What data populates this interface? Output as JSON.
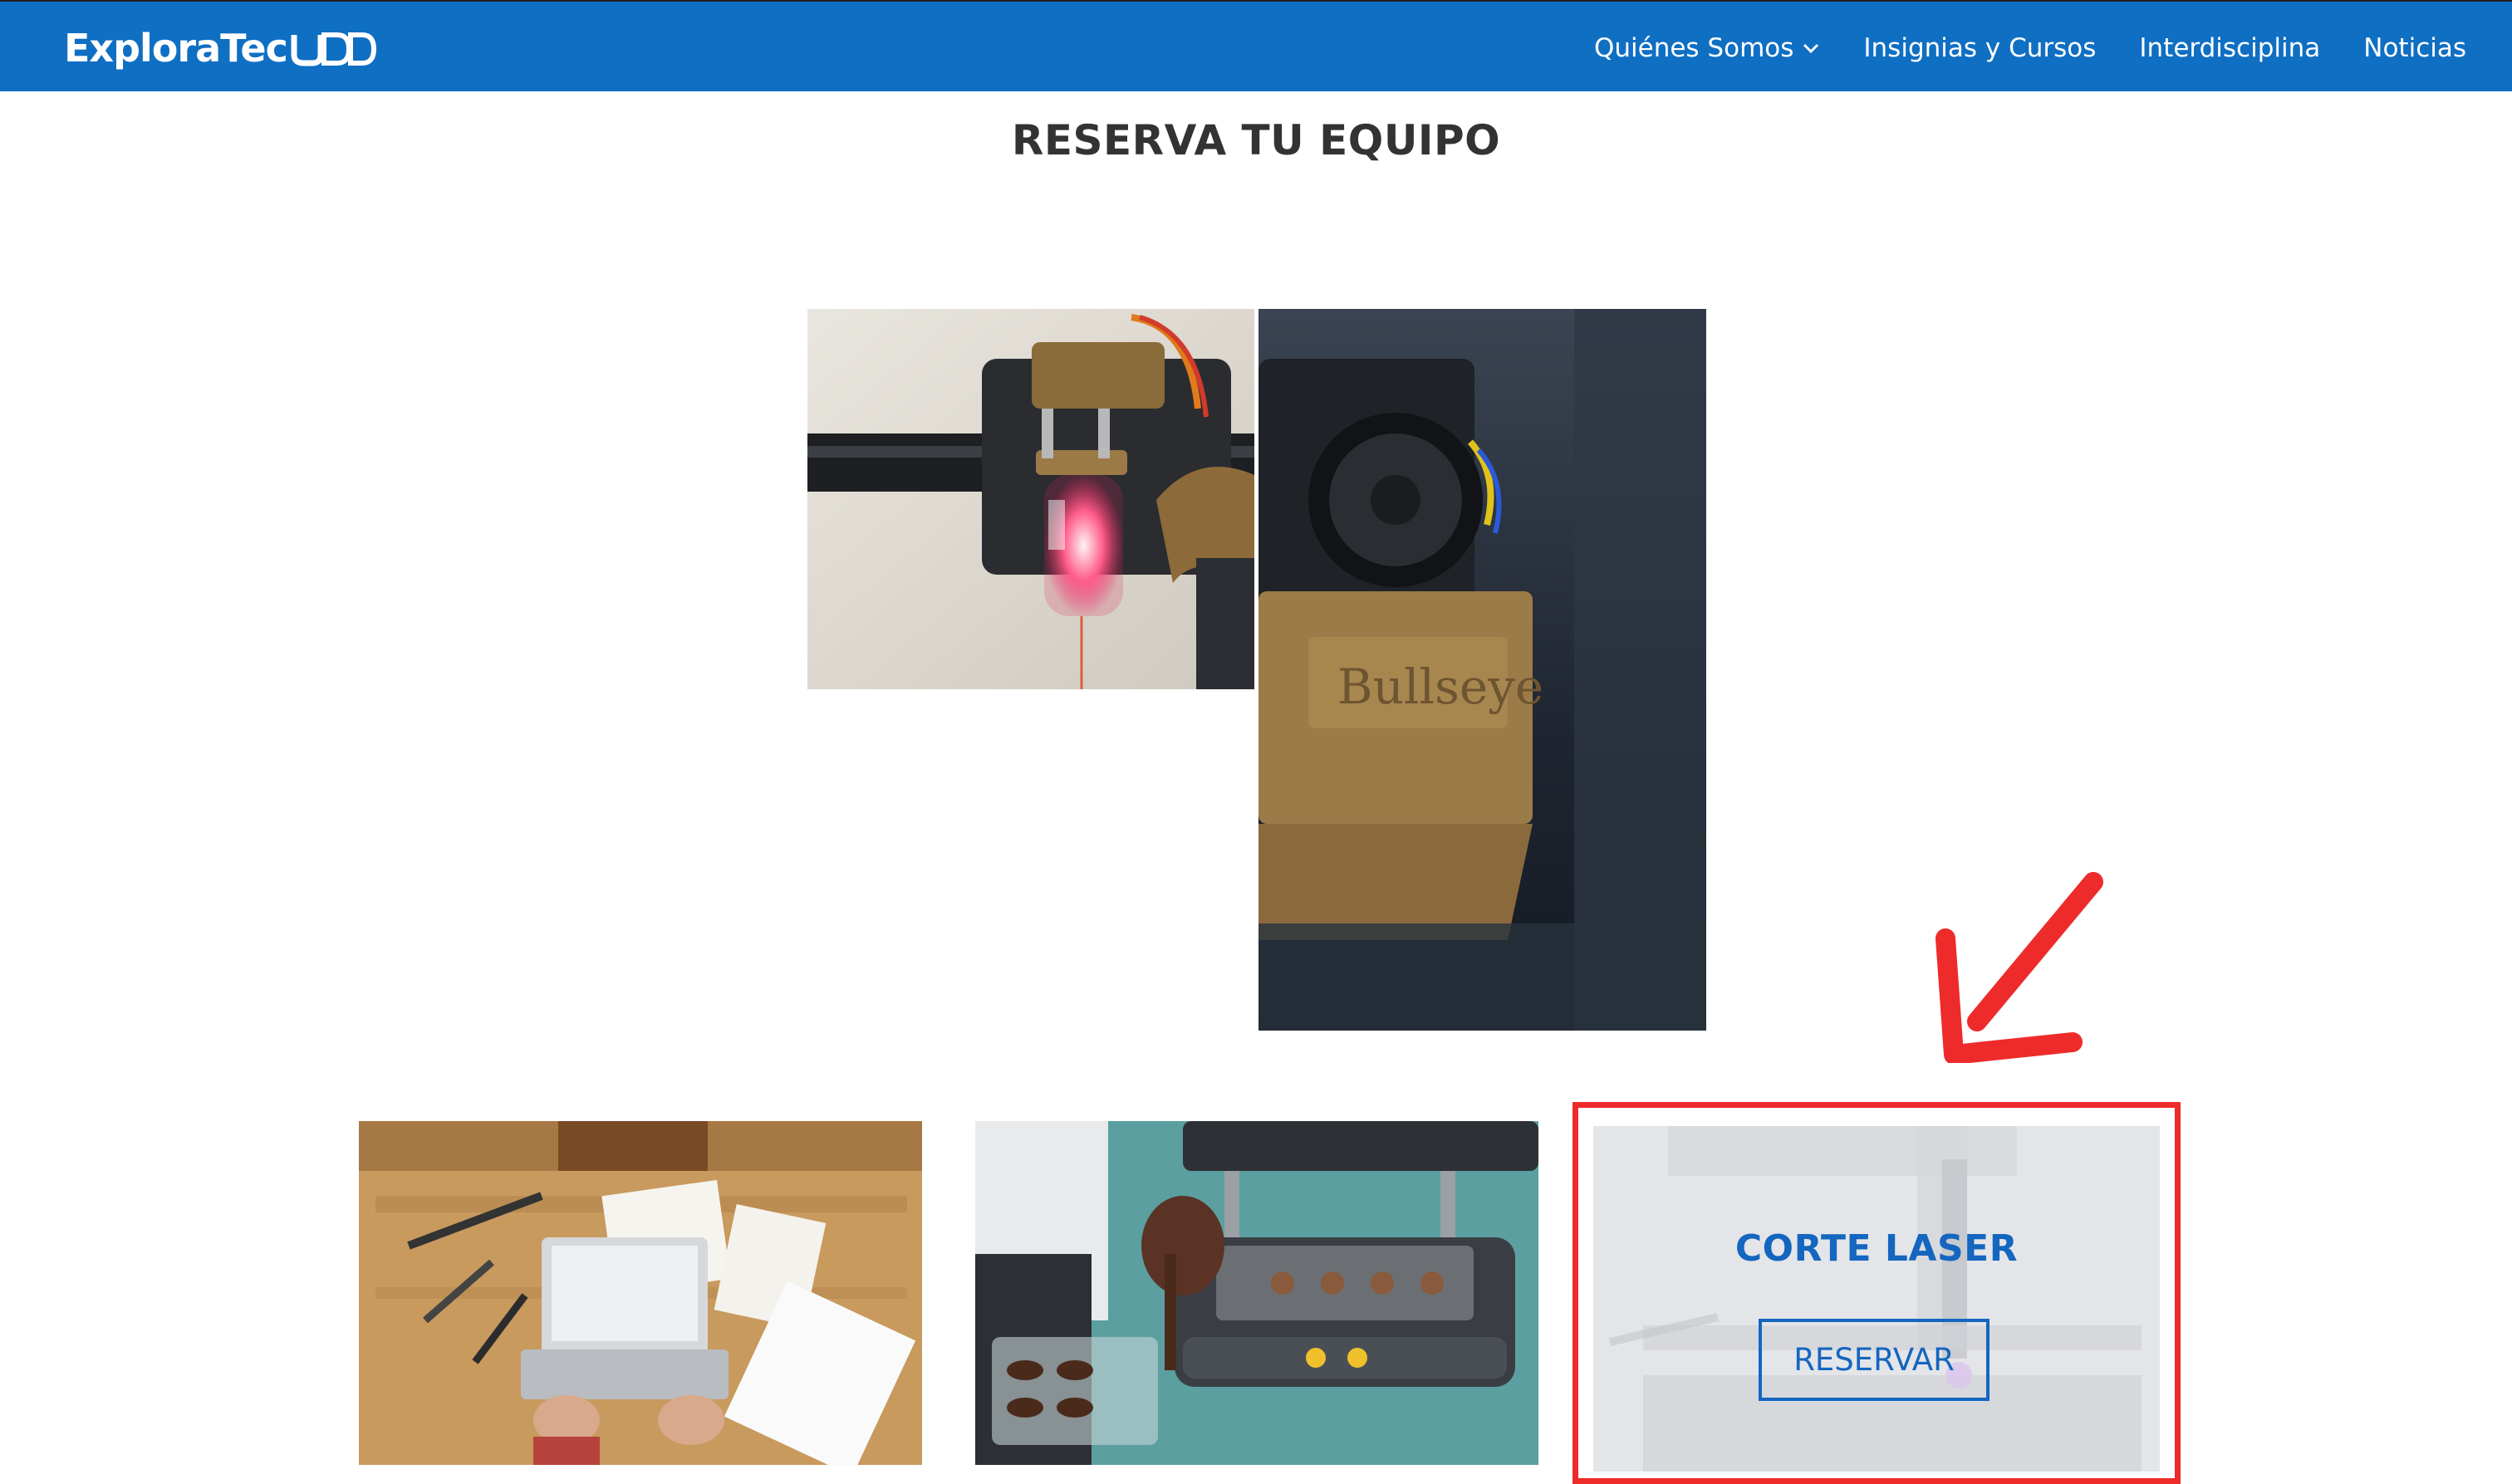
{
  "header": {
    "logo_text": "ExploraTec",
    "logo_suffix": "UDD",
    "nav": [
      {
        "label": "Quiénes Somos",
        "has_dropdown": true
      },
      {
        "label": "Insignias y Cursos"
      },
      {
        "label": "Interdisciplina"
      },
      {
        "label": "Noticias"
      }
    ]
  },
  "page": {
    "title": "RESERVA TU EQUIPO"
  },
  "cards": {
    "laser": {
      "title": "CORTE LASER",
      "button_label": "RESERVAR"
    }
  },
  "colors": {
    "nav_bg": "#0f6fc3",
    "accent_blue": "#1466bf",
    "highlight_red": "#ee2b2b",
    "title_text": "#333333"
  },
  "icons": {
    "dropdown": "chevron-down-icon",
    "annotation": "arrow-down-left-icon"
  }
}
